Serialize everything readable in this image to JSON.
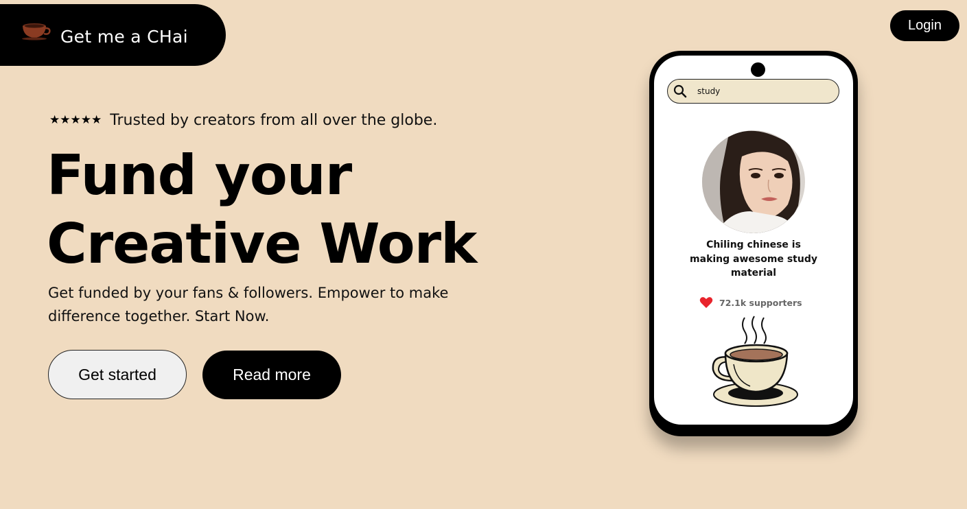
{
  "brand": {
    "title": "Get me a CHai",
    "icon": "coffee-cup-icon"
  },
  "nav": {
    "login_label": "Login"
  },
  "hero": {
    "rating_stars": 5,
    "trusted_text": "Trusted by creators from all over the globe.",
    "headline_line1": "Fund your",
    "headline_line2": "Creative Work",
    "subtext": "Get funded by your fans & followers. Empower to make difference together. Start Now.",
    "primary_button": "Get started",
    "secondary_button": "Read more"
  },
  "phone_preview": {
    "search_value": "study",
    "creator_title": "Chiling chinese is making awesome study material",
    "supporters_text": "72.1k supporters"
  },
  "colors": {
    "background": "#f0dbc0",
    "primary": "#000000",
    "search_bg": "#f0e6cc",
    "heart": "#e8242c"
  }
}
